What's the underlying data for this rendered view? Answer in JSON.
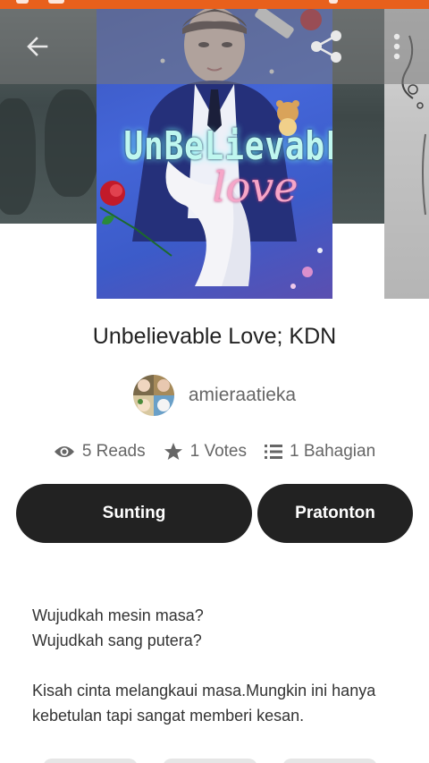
{
  "colors": {
    "status_bar": "#e8601c",
    "button_bg": "#222222",
    "button_text": "#ffffff",
    "muted_text": "#666666"
  },
  "toolbar": {
    "back_icon": "arrow-left-icon",
    "share_icon": "share-icon",
    "more_icon": "more-vertical-icon"
  },
  "cover": {
    "title_text": "UnBeLievabLe",
    "subtitle_text": "love"
  },
  "story": {
    "title": "Unbelievable Love; KDN",
    "author": "amieraatieka",
    "stats": {
      "reads": "5 Reads",
      "votes": "1 Votes",
      "parts": "1 Bahagian"
    }
  },
  "actions": {
    "edit_label": "Sunting",
    "preview_label": "Pratonton"
  },
  "description": {
    "line1": "Wujudkah mesin masa?",
    "line2": "Wujudkah sang putera?",
    "paragraph2": "Kisah cinta melangkaui masa.Mungkin ini hanya kebetulan tapi sangat memberi kesan."
  }
}
